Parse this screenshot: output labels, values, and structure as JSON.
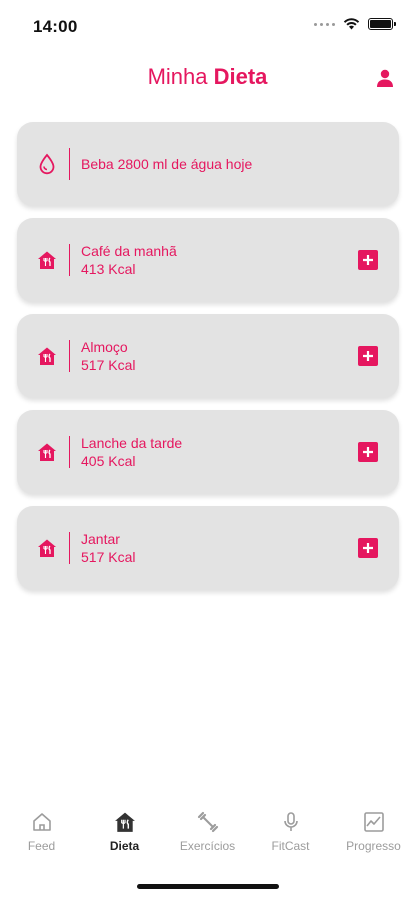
{
  "status_bar": {
    "time": "14:00"
  },
  "header": {
    "title_light": "Minha",
    "title_bold": "Dieta",
    "profile_icon": "person-icon"
  },
  "colors": {
    "accent": "#e5175f",
    "card_bg": "#e3e3e3",
    "inactive": "#9c9c9c"
  },
  "water": {
    "text": "Beba 2800 ml de água hoje",
    "icon": "water-drop-icon"
  },
  "meals": [
    {
      "name": "Café da manhã",
      "kcal": "413 Kcal"
    },
    {
      "name": "Almoço",
      "kcal": "517 Kcal"
    },
    {
      "name": "Lanche da tarde",
      "kcal": "405 Kcal"
    },
    {
      "name": "Jantar",
      "kcal": "517 Kcal"
    }
  ],
  "nav": {
    "items": [
      {
        "label": "Feed",
        "icon": "home-icon"
      },
      {
        "label": "Dieta",
        "icon": "diet-icon",
        "active": true
      },
      {
        "label": "Exercícios",
        "icon": "dumbbell-icon"
      },
      {
        "label": "FitCast",
        "icon": "microphone-icon"
      },
      {
        "label": "Progresso",
        "icon": "chart-icon"
      }
    ]
  }
}
